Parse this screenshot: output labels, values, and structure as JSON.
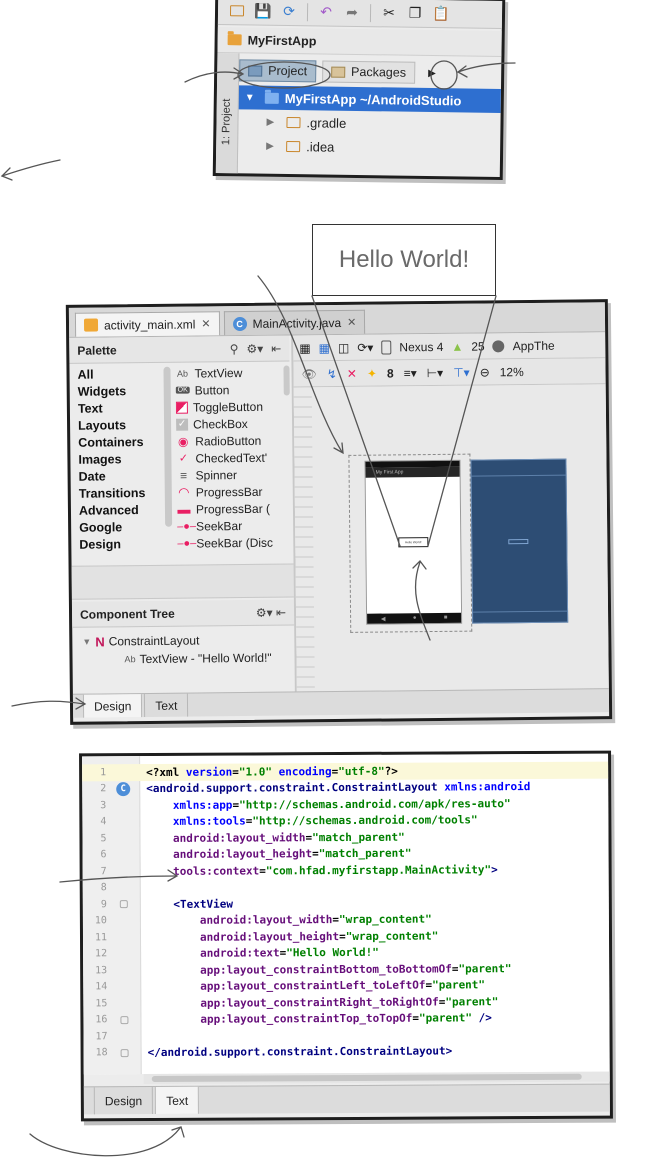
{
  "project_panel": {
    "breadcrumb": "MyFirstApp",
    "side_tab": "1: Project",
    "tabs": [
      {
        "label": "Project",
        "active": true
      },
      {
        "label": "Packages",
        "active": false
      }
    ],
    "tree": [
      {
        "label": "MyFirstApp ~/AndroidStudio",
        "selected": true
      },
      {
        "label": ".gradle",
        "selected": false
      },
      {
        "label": ".idea",
        "selected": false
      }
    ]
  },
  "zoom_callout": {
    "text": "Hello World!"
  },
  "layout_editor": {
    "file_tabs": [
      {
        "label": "activity_main.xml",
        "icon": "xml-file-icon",
        "active": true
      },
      {
        "label": "MainActivity.java",
        "icon": "class-icon",
        "active": false
      }
    ],
    "palette": {
      "title": "Palette",
      "categories": [
        "All",
        "Widgets",
        "Text",
        "Layouts",
        "Containers",
        "Images",
        "Date",
        "Transitions",
        "Advanced",
        "Google",
        "Design"
      ],
      "items": [
        {
          "label": "TextView",
          "icon": "Ab"
        },
        {
          "label": "Button",
          "icon": "OK"
        },
        {
          "label": "ToggleButton",
          "icon": "toggle-icon"
        },
        {
          "label": "CheckBox",
          "icon": "checkbox-icon"
        },
        {
          "label": "RadioButton",
          "icon": "radio-icon"
        },
        {
          "label": "CheckedText'",
          "icon": "checked-text-icon"
        },
        {
          "label": "Spinner",
          "icon": "spinner-icon"
        },
        {
          "label": "ProgressBar",
          "icon": "progress-circle-icon"
        },
        {
          "label": "ProgressBar (",
          "icon": "progress-bar-icon"
        },
        {
          "label": "SeekBar",
          "icon": "seekbar-icon"
        },
        {
          "label": "SeekBar (Disc",
          "icon": "seekbar-icon"
        }
      ]
    },
    "component_tree": {
      "title": "Component Tree",
      "root": "ConstraintLayout",
      "child": "TextView - \"Hello World!\""
    },
    "toolbar": {
      "device": "Nexus 4",
      "api": "25",
      "theme": "AppThe",
      "margin": "8",
      "zoom": "12%"
    },
    "phone_title": "My First App",
    "phone_text": "Hello World!",
    "bottom_tabs": [
      {
        "label": "Design",
        "active": true
      },
      {
        "label": "Text",
        "active": false
      }
    ]
  },
  "code_editor": {
    "lines": [
      {
        "n": "1"
      },
      {
        "n": "2"
      },
      {
        "n": "3"
      },
      {
        "n": "4"
      },
      {
        "n": "5"
      },
      {
        "n": "6"
      },
      {
        "n": "7"
      },
      {
        "n": "8"
      },
      {
        "n": "9"
      },
      {
        "n": "10"
      },
      {
        "n": "11"
      },
      {
        "n": "12"
      },
      {
        "n": "13"
      },
      {
        "n": "14"
      },
      {
        "n": "15"
      },
      {
        "n": "16"
      },
      {
        "n": "17"
      },
      {
        "n": "18"
      }
    ],
    "tokens": {
      "l1_a": "<?xml ",
      "l1_b": "version",
      "l1_c": "=",
      "l1_d": "\"1.0\"",
      "l1_e": " encoding",
      "l1_f": "=",
      "l1_g": "\"utf-8\"",
      "l1_h": "?>",
      "l2_a": "<android.support.constraint.ConstraintLayout ",
      "l2_b": "xmlns:android",
      "l3_a": "xmlns:app",
      "l3_b": "=",
      "l3_c": "\"http://schemas.android.com/apk/res-auto\"",
      "l4_a": "xmlns:tools",
      "l4_b": "=",
      "l4_c": "\"http://schemas.android.com/tools\"",
      "l5_a": "android",
      "l5_b": ":layout_width",
      "l5_c": "=",
      "l5_d": "\"match_parent\"",
      "l6_a": "android",
      "l6_b": ":layout_height",
      "l6_c": "=",
      "l6_d": "\"match_parent\"",
      "l7_a": "tools",
      "l7_b": ":context",
      "l7_c": "=",
      "l7_d": "\"com.hfad.myfirstapp.MainActivity\"",
      "l7_e": ">",
      "l9_a": "<TextView",
      "l10_a": "android",
      "l10_b": ":layout_width",
      "l10_c": "=",
      "l10_d": "\"wrap_content\"",
      "l11_a": "android",
      "l11_b": ":layout_height",
      "l11_c": "=",
      "l11_d": "\"wrap_content\"",
      "l12_a": "android",
      "l12_b": ":text",
      "l12_c": "=",
      "l12_d": "\"Hello World!\"",
      "l13_a": "app",
      "l13_b": ":layout_constraintBottom_toBottomOf",
      "l13_c": "=",
      "l13_d": "\"parent\"",
      "l14_a": "app",
      "l14_b": ":layout_constraintLeft_toLeftOf",
      "l14_c": "=",
      "l14_d": "\"parent\"",
      "l15_a": "app",
      "l15_b": ":layout_constraintRight_toRightOf",
      "l15_c": "=",
      "l15_d": "\"parent\"",
      "l16_a": "app",
      "l16_b": ":layout_constraintTop_toTopOf",
      "l16_c": "=",
      "l16_d": "\"parent\"",
      "l16_e": " />",
      "l18_a": "</android.support.constraint.ConstraintLayout>"
    },
    "bottom_tabs": [
      {
        "label": "Design",
        "active": false
      },
      {
        "label": "Text",
        "active": true
      }
    ]
  },
  "colors": {
    "selection": "#2e6fd0",
    "xml_tag": "#000080",
    "xml_attr": "#660e7a",
    "xml_namespace": "#0000ff",
    "xml_value": "#008000",
    "blueprint": "#2d4d74"
  }
}
